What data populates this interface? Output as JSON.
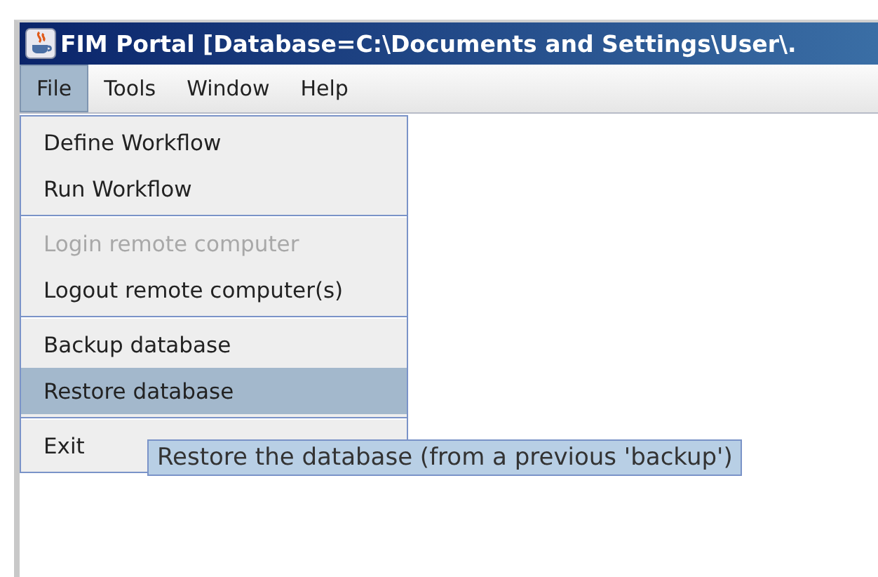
{
  "window": {
    "title": "FIM Portal  [Database=C:\\Documents and Settings\\User\\."
  },
  "menubar": [
    {
      "label": "File",
      "selected": true
    },
    {
      "label": "Tools",
      "selected": false
    },
    {
      "label": "Window",
      "selected": false
    },
    {
      "label": "Help",
      "selected": false
    }
  ],
  "menu": {
    "groups": [
      [
        {
          "label": "Define Workflow",
          "disabled": false,
          "selected": false
        },
        {
          "label": "Run Workflow",
          "disabled": false,
          "selected": false
        }
      ],
      [
        {
          "label": "Login remote computer",
          "disabled": true,
          "selected": false
        },
        {
          "label": "Logout remote computer(s)",
          "disabled": false,
          "selected": false
        }
      ],
      [
        {
          "label": "Backup database",
          "disabled": false,
          "selected": false
        },
        {
          "label": "Restore database",
          "disabled": false,
          "selected": true
        }
      ],
      [
        {
          "label": "Exit",
          "disabled": false,
          "selected": false
        }
      ]
    ]
  },
  "tooltip": "Restore the database (from a previous 'backup')"
}
